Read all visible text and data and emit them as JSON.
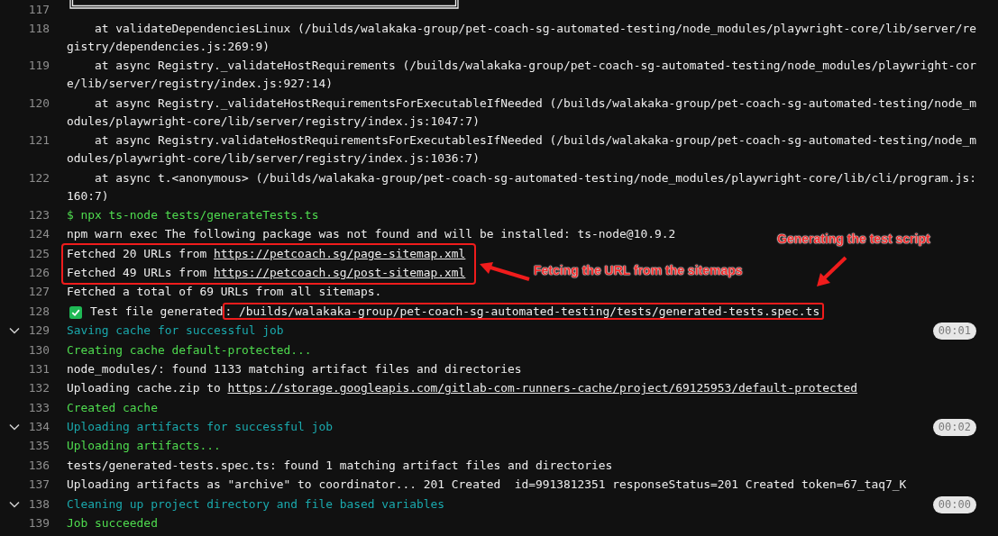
{
  "lines": [
    {
      "number": "117",
      "kind": "frame"
    },
    {
      "number": "118",
      "kind": "plain",
      "text": "    at validateDependenciesLinux (/builds/walakaka-group/pet-coach-sg-automated-testing/node_modules/playwright-core/lib/server/registry/dependencies.js:269:9)"
    },
    {
      "number": "119",
      "kind": "plain",
      "text": "    at async Registry._validateHostRequirements (/builds/walakaka-group/pet-coach-sg-automated-testing/node_modules/playwright-core/lib/server/registry/index.js:927:14)"
    },
    {
      "number": "120",
      "kind": "plain",
      "text": "    at async Registry._validateHostRequirementsForExecutableIfNeeded (/builds/walakaka-group/pet-coach-sg-automated-testing/node_modules/playwright-core/lib/server/registry/index.js:1047:7)"
    },
    {
      "number": "121",
      "kind": "plain",
      "text": "    at async Registry.validateHostRequirementsForExecutablesIfNeeded (/builds/walakaka-group/pet-coach-sg-automated-testing/node_modules/playwright-core/lib/server/registry/index.js:1036:7)"
    },
    {
      "number": "122",
      "kind": "plain",
      "text": "    at async t.<anonymous> (/builds/walakaka-group/pet-coach-sg-automated-testing/node_modules/playwright-core/lib/cli/program.js:160:7)"
    },
    {
      "number": "123",
      "kind": "command",
      "text": "$ npx ts-node tests/generateTests.ts"
    },
    {
      "number": "124",
      "kind": "plain",
      "text": "npm warn exec The following package was not found and will be installed: ts-node@10.9.2"
    },
    {
      "number": "125",
      "kind": "plain",
      "text": "Fetched 20 URLs from ",
      "link": "https://petcoach.sg/page-sitemap.xml"
    },
    {
      "number": "126",
      "kind": "plain",
      "text": "Fetched 49 URLs from ",
      "link": "https://petcoach.sg/post-sitemap.xml"
    },
    {
      "number": "127",
      "kind": "plain",
      "text": "Fetched a total of 69 URLs from all sitemaps."
    },
    {
      "number": "128",
      "kind": "check",
      "text": "Test file generated",
      "highlight": ": /builds/walakaka-group/pet-coach-sg-automated-testing/tests/generated-tests.spec.ts"
    },
    {
      "number": "129",
      "kind": "section",
      "expanded": true,
      "text": "Saving cache for successful job",
      "duration": "00:01"
    },
    {
      "number": "130",
      "kind": "success",
      "text": "Creating cache default-protected..."
    },
    {
      "number": "131",
      "kind": "plain",
      "text": "node_modules/: found 1133 matching artifact files and directories"
    },
    {
      "number": "132",
      "kind": "plain",
      "text": "Uploading cache.zip to ",
      "link": "https://storage.googleapis.com/gitlab-com-runners-cache/project/69125953/default-protected"
    },
    {
      "number": "133",
      "kind": "success",
      "text": "Created cache"
    },
    {
      "number": "134",
      "kind": "section",
      "expanded": true,
      "text": "Uploading artifacts for successful job",
      "duration": "00:02"
    },
    {
      "number": "135",
      "kind": "success",
      "text": "Uploading artifacts..."
    },
    {
      "number": "136",
      "kind": "plain",
      "text": "tests/generated-tests.spec.ts: found 1 matching artifact files and directories"
    },
    {
      "number": "137",
      "kind": "plain",
      "text": "Uploading artifacts as \"archive\" to coordinator... 201 Created  id=9913812351 responseStatus=201 Created token=67_taq7_K"
    },
    {
      "number": "138",
      "kind": "section",
      "expanded": true,
      "text": "Cleaning up project directory and file based variables",
      "duration": "00:00"
    },
    {
      "number": "139",
      "kind": "success",
      "text": "Job succeeded"
    }
  ],
  "annotations": [
    {
      "text": "Fetcing the URL from the sitemaps"
    },
    {
      "text": "Generating the test script"
    }
  ]
}
